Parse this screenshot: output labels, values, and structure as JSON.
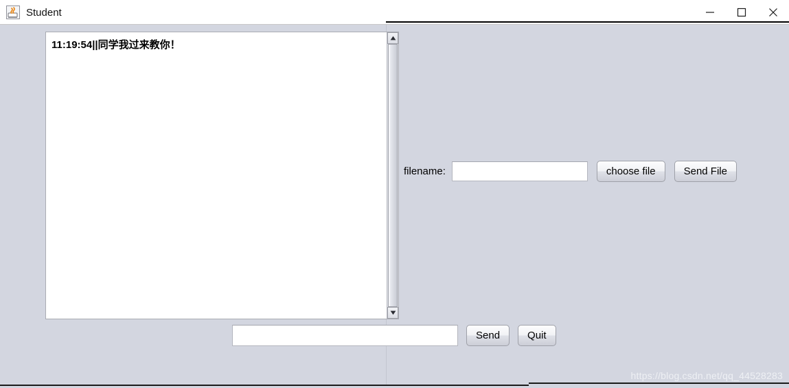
{
  "window": {
    "title": "Student",
    "app_icon": "java-coffee-cup-icon",
    "controls": {
      "minimize": "minimize-icon",
      "maximize": "maximize-icon",
      "close": "close-icon"
    }
  },
  "chat": {
    "messages": [
      "11:19:54||同学我过来教你！"
    ],
    "scrollbar": {
      "up_arrow": "scroll-up-icon",
      "down_arrow": "scroll-down-icon"
    }
  },
  "file_panel": {
    "label": "filename:",
    "filename_value": "",
    "filename_placeholder": "",
    "choose_file_label": "choose file",
    "send_file_label": "Send File"
  },
  "message_bar": {
    "message_value": "",
    "message_placeholder": "",
    "send_label": "Send",
    "quit_label": "Quit"
  },
  "watermark": {
    "text": "https://blog.csdn.net/qq_44528283"
  },
  "colors": {
    "window_background": "#d3d6e0",
    "titlebar_background": "#ffffff",
    "text_area_background": "#ffffff",
    "button_face": "#eceef3",
    "border": "#9ea0a8",
    "watermark_text": "#eef0f4"
  }
}
